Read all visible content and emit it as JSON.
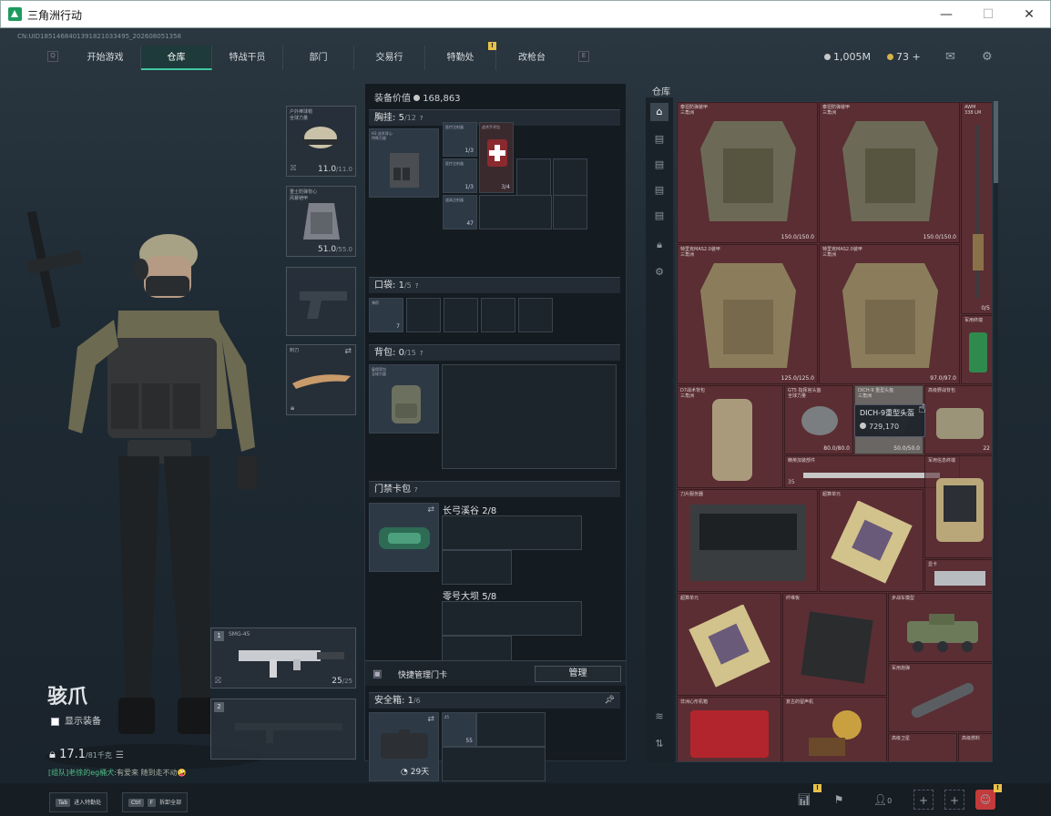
{
  "window": {
    "title": "三角洲行动",
    "minimize": "—",
    "maximize": "☐",
    "close": "✕"
  },
  "header": {
    "uid": "CN:UID1851468401391821033495_202608051358",
    "left_key": "Q",
    "right_key": "E",
    "tabs": [
      "开始游戏",
      "仓库",
      "特战干员",
      "部门",
      "交易行",
      "特勤处",
      "改枪台"
    ],
    "active_tab": "仓库",
    "badge_tab": "特勤处",
    "badge": "!",
    "currency_silver": "1,005M",
    "currency_gold": "73",
    "currency_gold_plus": "+",
    "colors": {
      "accent": "#3fc9a0",
      "badge": "#e8c14a",
      "stash_bg": "#5a2e33"
    }
  },
  "character": {
    "name": "骇爪",
    "show_gear_label": "显示装备",
    "weight_value": "17.1",
    "weight_max": "/81千克",
    "chat_name": "[组队]老徐的eg桶犬",
    "chat_text": ":有爱来 随到走不动",
    "chat_emoji": "🤪"
  },
  "equip_slots": {
    "helmet": {
      "name": "户外棒球帽\n全球力量",
      "value": "11.0",
      "max": "/11.0"
    },
    "armor": {
      "name": "重士防弹背心\n风暴铠甲",
      "value": "51.0",
      "max": "/55.0"
    },
    "melee": {
      "name": "刺刀"
    },
    "weapon1": {
      "hotkey": "1",
      "name": "SMG-45",
      "ammo": "25",
      "ammo_max": "/25"
    },
    "weapon2": {
      "hotkey": "2"
    }
  },
  "middle": {
    "value_label": "装备价值",
    "value": "168,863",
    "sections": {
      "chest": {
        "title": "胸挂",
        "count": "5",
        "max": "/12"
      },
      "pocket": {
        "title": "口袋",
        "count": "1",
        "max": "/5"
      },
      "backpack": {
        "title": "背包",
        "count": "0",
        "max": "/15"
      },
      "keycard": {
        "title": "门禁卡包"
      },
      "safe": {
        "title": "安全箱",
        "count": "1",
        "max": "/6"
      }
    },
    "chest_items": [
      {
        "name": "H3 战术背心\n特殊力量",
        "v": ""
      },
      {
        "name": "医疗注射器",
        "v": "1/3"
      },
      {
        "name": "战术手术包",
        "v": "3/4"
      },
      {
        "name": "道具注射器",
        "v": "47"
      },
      {
        "name": "精确注射器",
        "v": "60"
      }
    ],
    "pocket_item": {
      "name": "弹药",
      "v": "7"
    },
    "backpack_item": {
      "name": "雇佣背包\n全球力量"
    },
    "keycard_sub1": {
      "title": "长弓溪谷",
      "count": "2/8"
    },
    "keycard_sub2": {
      "title": "零号大坝",
      "count": "5/8"
    },
    "keycard_manage_label": "快捷管理门卡",
    "manage_button": "管理",
    "safe_item": {
      "name": "45",
      "v": "55"
    },
    "safe_timer": "29天"
  },
  "stash": {
    "label": "仓库",
    "items": [
      {
        "name": "泰坦防弹装甲\n三角洲",
        "v": "150.0/150.0"
      },
      {
        "name": "泰坦防弹装甲\n三角洲",
        "v": "150.0/150.0"
      },
      {
        "name": "AWM\n338 LM",
        "v": "0/5"
      },
      {
        "name": "特里克MAS2.0装甲\n三角洲",
        "v": "125.0/125.0"
      },
      {
        "name": "特里克MAS2.0装甲\n三角洲",
        "v": "97.0/97.0"
      },
      {
        "name": "军用终端",
        "v": ""
      },
      {
        "name": "D7战术背包\n三角洲",
        "v": ""
      },
      {
        "name": "GT5 指挥官头盔\n全球力量",
        "v": "80.0/80.0"
      },
      {
        "name": "DICH-9 重型头盔\n三角洲",
        "v": "50.0/50.0"
      },
      {
        "name": "高级野战背包",
        "v": "22"
      },
      {
        "name": "精英加装部件",
        "v": "35"
      },
      {
        "name": "军用信息终端",
        "v": ""
      },
      {
        "name": "刀片服务器",
        "v": ""
      },
      {
        "name": "超算单元",
        "v": ""
      },
      {
        "name": "显卡",
        "v": ""
      },
      {
        "name": "超算单元",
        "v": ""
      },
      {
        "name": "纤维板",
        "v": ""
      },
      {
        "name": "步战车模型",
        "v": ""
      },
      {
        "name": "军用炮弹",
        "v": ""
      },
      {
        "name": "非洲心形机箱",
        "v": ""
      },
      {
        "name": "复古的留声机",
        "v": ""
      },
      {
        "name": "高级卫星",
        "v": ""
      },
      {
        "name": "高级燃料",
        "v": ""
      }
    ],
    "tooltip": {
      "name": "DICH-9重型头盔",
      "price": "729,170"
    }
  },
  "bottom": {
    "hint1_key": "Tab",
    "hint1_text": "进入特勤处",
    "hint2_key": "Ctrl",
    "hint2_key2": "F",
    "hint2_text": "拆卸全部",
    "friends_count": "0"
  }
}
